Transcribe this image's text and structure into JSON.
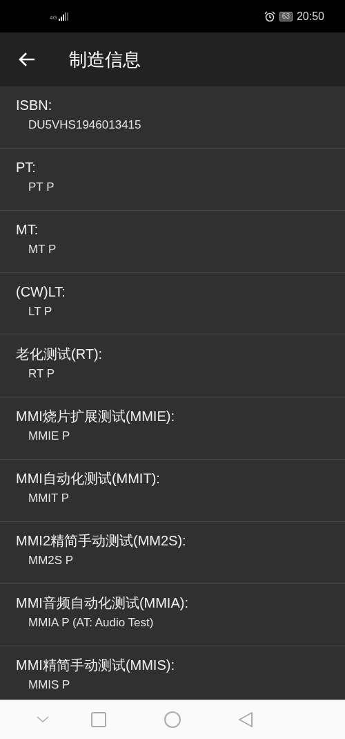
{
  "status_bar": {
    "network": "4G",
    "battery": "63",
    "time": "20:50"
  },
  "app_bar": {
    "title": "制造信息"
  },
  "items": [
    {
      "label": "ISBN:",
      "value": "DU5VHS1946013415"
    },
    {
      "label": "PT:",
      "value": "PT P"
    },
    {
      "label": "MT:",
      "value": "MT P"
    },
    {
      "label": "(CW)LT:",
      "value": "LT P"
    },
    {
      "label": "老化测试(RT):",
      "value": "RT P"
    },
    {
      "label": "MMI烧片扩展测试(MMIE):",
      "value": "MMIE P"
    },
    {
      "label": "MMI自动化测试(MMIT):",
      "value": "MMIT P"
    },
    {
      "label": "MMI2精简手动测试(MM2S):",
      "value": "MM2S P"
    },
    {
      "label": "MMI音频自动化测试(MMIA):",
      "value": "MMIA P (AT: Audio Test)"
    },
    {
      "label": "MMI精简手动测试(MMIS):",
      "value": "MMIS P"
    }
  ]
}
